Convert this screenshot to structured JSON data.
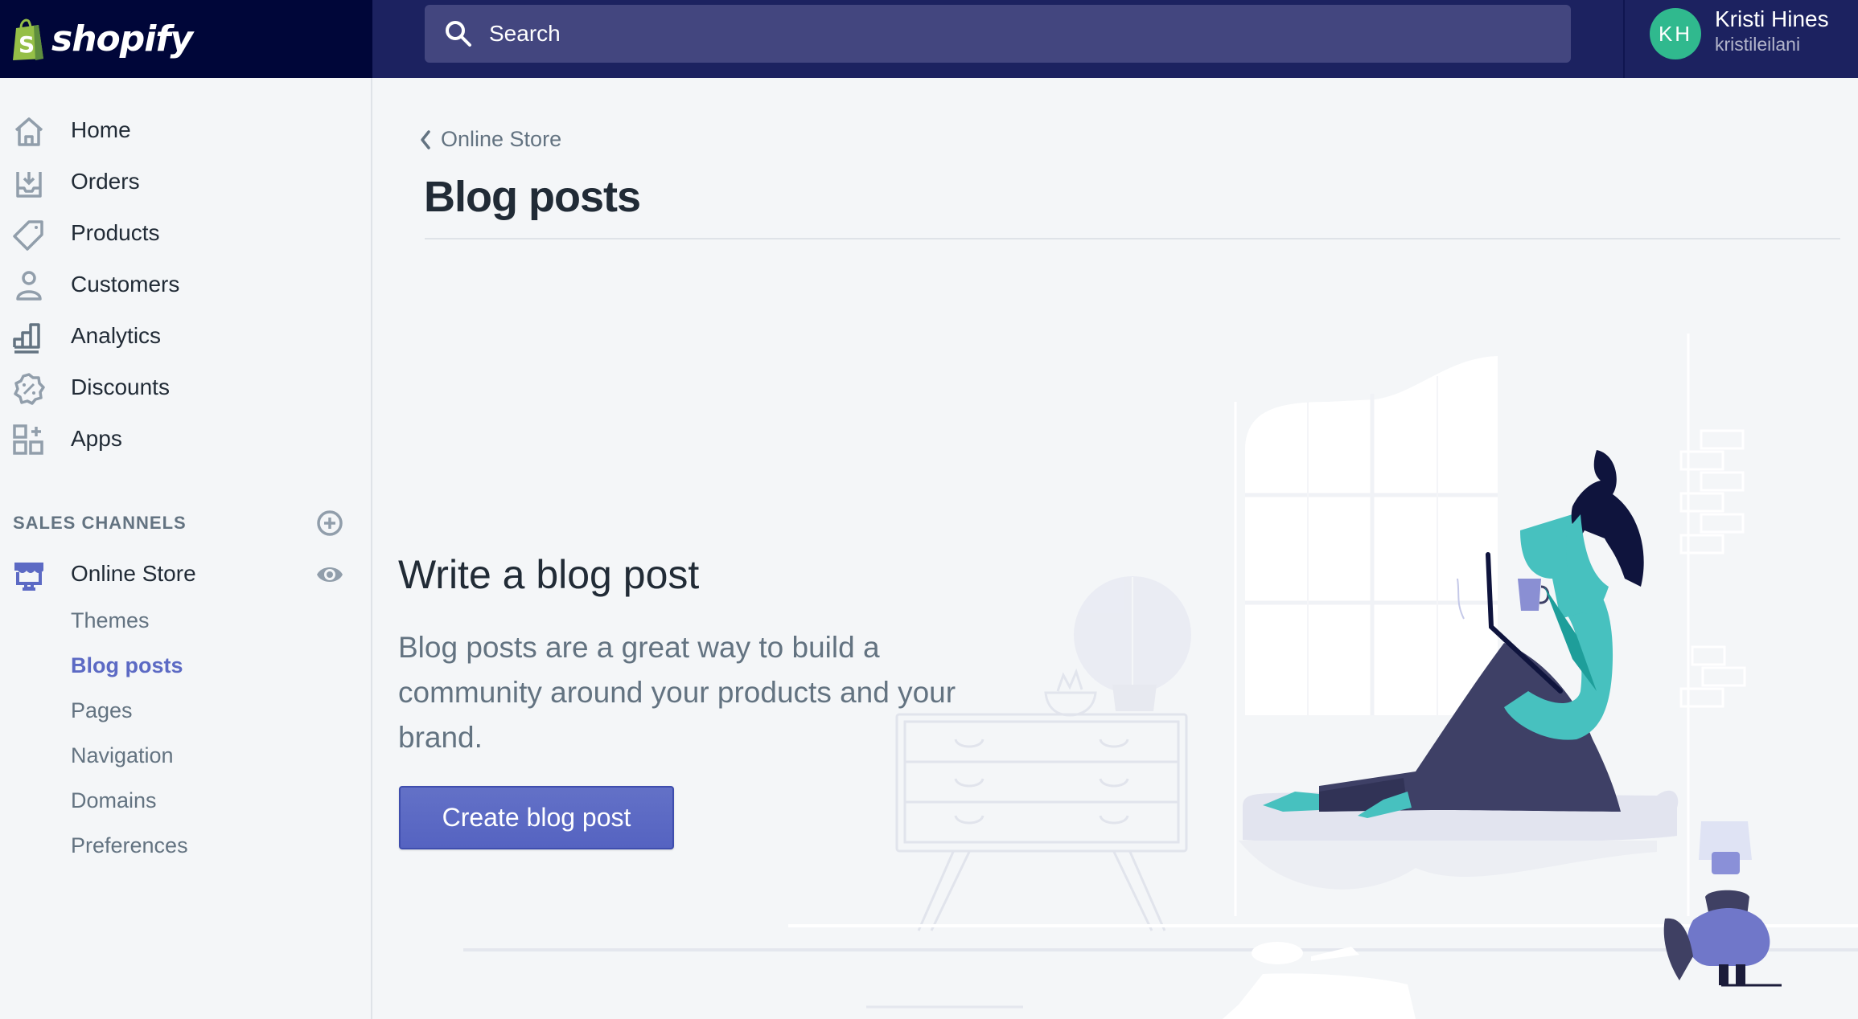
{
  "topbar": {
    "brand": "shopify",
    "search_placeholder": "Search",
    "user": {
      "initials": "KH",
      "name": "Kristi Hines",
      "handle": "kristileilani",
      "avatar_color": "#30b98e"
    }
  },
  "sidebar": {
    "items": [
      {
        "label": "Home",
        "icon": "home-icon"
      },
      {
        "label": "Orders",
        "icon": "orders-inbox-icon"
      },
      {
        "label": "Products",
        "icon": "tag-icon"
      },
      {
        "label": "Customers",
        "icon": "person-icon"
      },
      {
        "label": "Analytics",
        "icon": "bar-chart-icon"
      },
      {
        "label": "Discounts",
        "icon": "discount-badge-icon"
      },
      {
        "label": "Apps",
        "icon": "apps-grid-icon"
      }
    ],
    "sales_channels_label": "SALES CHANNELS",
    "channel": {
      "label": "Online Store",
      "icon": "storefront-icon",
      "subitems": [
        {
          "label": "Themes",
          "active": false
        },
        {
          "label": "Blog posts",
          "active": true
        },
        {
          "label": "Pages",
          "active": false
        },
        {
          "label": "Navigation",
          "active": false
        },
        {
          "label": "Domains",
          "active": false
        },
        {
          "label": "Preferences",
          "active": false
        }
      ]
    }
  },
  "page": {
    "breadcrumb": "Online Store",
    "title": "Blog posts",
    "empty_state": {
      "heading": "Write a blog post",
      "text": "Blog posts are a great way to build a community around your products and your brand.",
      "button": "Create blog post"
    }
  },
  "colors": {
    "topbar": "#1c2260",
    "logo_bg": "#000639",
    "accent": "#5c6ac4",
    "search_bg": "#43467f"
  }
}
